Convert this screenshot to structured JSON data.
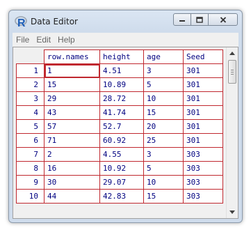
{
  "window": {
    "title": "Data Editor",
    "logo_letter": "R",
    "colors": {
      "accent": "#c0282f",
      "cell_text": "#000080",
      "logo": "#1f5fb8"
    }
  },
  "menu": [
    "File",
    "Edit",
    "Help"
  ],
  "table": {
    "headers": [
      "row.names",
      "height",
      "age",
      "Seed"
    ],
    "row_numbers": [
      "1",
      "2",
      "3",
      "4",
      "5",
      "6",
      "7",
      "8",
      "9",
      "10"
    ],
    "rows": [
      [
        "1",
        "4.51",
        "3",
        "301"
      ],
      [
        "15",
        "10.89",
        "5",
        "301"
      ],
      [
        "29",
        "28.72",
        "10",
        "301"
      ],
      [
        "43",
        "41.74",
        "15",
        "301"
      ],
      [
        "57",
        "52.7",
        "20",
        "301"
      ],
      [
        "71",
        "60.92",
        "25",
        "301"
      ],
      [
        "2",
        "4.55",
        "3",
        "303"
      ],
      [
        "16",
        "10.92",
        "5",
        "303"
      ],
      [
        "30",
        "29.07",
        "10",
        "303"
      ],
      [
        "44",
        "42.83",
        "15",
        "303"
      ]
    ]
  },
  "scrollbar": {
    "up_icon": "triangle-up",
    "down_icon": "triangle-down"
  }
}
